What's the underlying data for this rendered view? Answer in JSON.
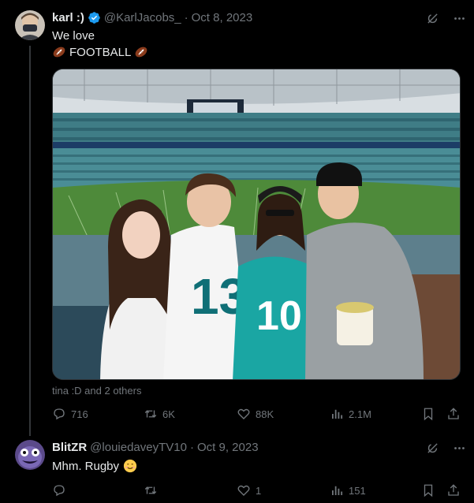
{
  "post": {
    "author_name": "karl :)",
    "handle": "@KarlJacobs_",
    "date": "Oct 8, 2023",
    "text_line1": "We love",
    "text_line2": "FOOTBALL",
    "tagged": "tina :D and 2 others",
    "stats": {
      "replies": "716",
      "reposts": "6K",
      "likes": "88K",
      "views": "2.1M"
    },
    "icons": [
      "grok-icon",
      "more-icon",
      "football-emoji",
      "verified-badge"
    ]
  },
  "reply": {
    "author_name": "BlitZR",
    "handle": "@louiedaveyTV10",
    "date": "Oct 9, 2023",
    "text": "Mhm. Rugby",
    "stats": {
      "replies": "",
      "reposts": "",
      "likes": "1",
      "views": "151"
    }
  },
  "colors": {
    "background": "#000000",
    "text": "#e7e9ea",
    "muted": "#71767b",
    "verified": "#1d9bf0",
    "divider": "#2f3336"
  }
}
